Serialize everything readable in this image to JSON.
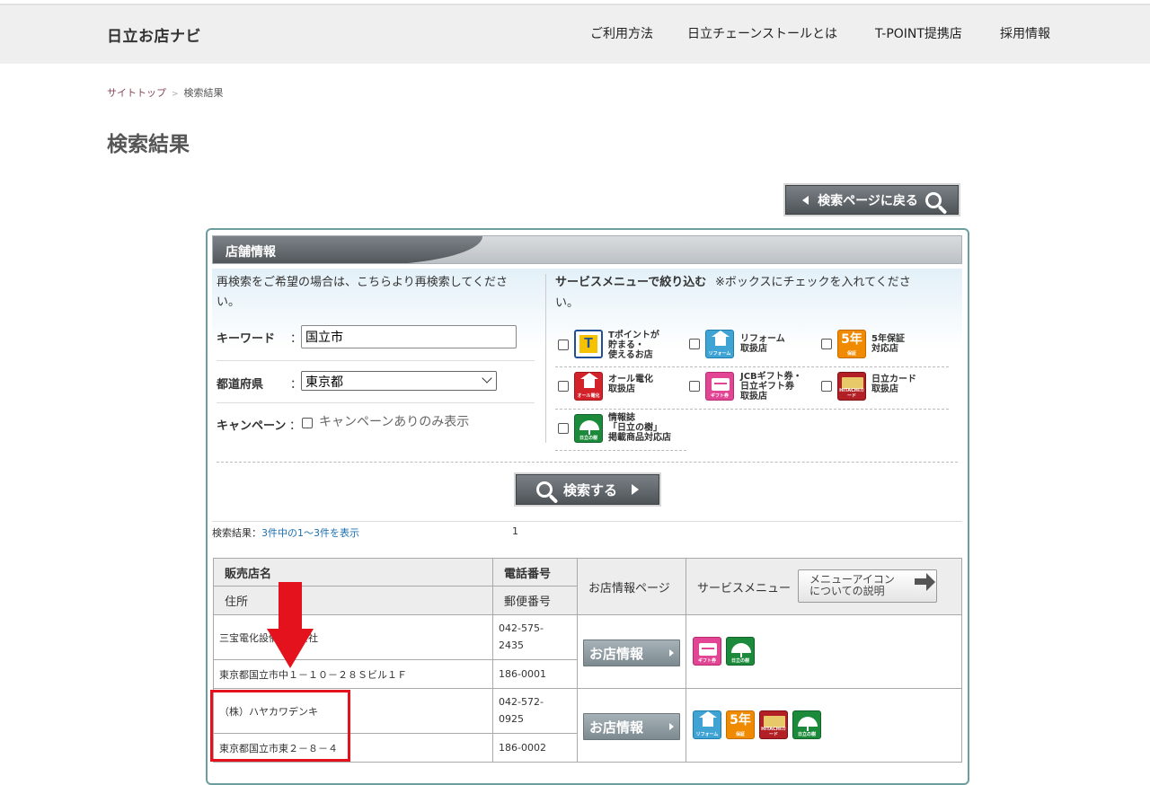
{
  "header": {
    "logo": "日立お店ナビ",
    "nav": [
      "ご利用方法",
      "日立チェーンストールとは",
      "T-POINT提携店",
      "採用情報"
    ]
  },
  "breadcrumb": {
    "home": "サイトトップ",
    "sep": ">",
    "current": "検索結果"
  },
  "page_title": "検索結果",
  "back_button": "検索ページに戻る",
  "panel": {
    "title": "店舗情報",
    "instructions_line1": "再検索をご希望の場合は、こちらより再検索してくださ",
    "instructions_line2": "い。",
    "keyword_label": "キーワード",
    "keyword_value": "国立市",
    "pref_label": "都道府県",
    "pref_value": "東京都",
    "campaign_label": "キャンペーン",
    "campaign_option": "キャンペーンありのみ表示",
    "colon": "：",
    "service_title": "サービスメニューで絞り込む",
    "service_note_line1": "※ボックスにチェックを入れてくださ",
    "service_note_line2": "い。",
    "services": [
      {
        "icon": "t-point-icon",
        "line1": "Tポイントが",
        "line2": "貯まる・",
        "line3": "使えるお店"
      },
      {
        "icon": "reform-icon",
        "line1": "リフォーム",
        "line2": "取扱店",
        "line3": ""
      },
      {
        "icon": "5year-warranty-icon",
        "line1": "5年保証",
        "line2": "対応店",
        "line3": ""
      },
      {
        "icon": "all-electric-icon",
        "line1": "オール電化",
        "line2": "取扱店",
        "line3": ""
      },
      {
        "icon": "gift-card-icon",
        "line1": "JCBギフト券・",
        "line2": "日立ギフト券",
        "line3": "取扱店"
      },
      {
        "icon": "hitachi-card-icon",
        "line1": "日立カード",
        "line2": "取扱店",
        "line3": ""
      },
      {
        "icon": "hitachi-tree-icon",
        "line1": "情報誌",
        "line2": "「日立の樹」",
        "line3": "掲載商品対応店"
      }
    ],
    "search_button": "検索する"
  },
  "results": {
    "summary_prefix": "検索結果：",
    "summary_link": "3件中の1～3件を表示",
    "page": "1",
    "headers": {
      "shop_name": "販売店名",
      "phone": "電話番号",
      "address": "住所",
      "postal": "郵便番号",
      "shop_page": "お店情報ページ",
      "service_menu": "サービスメニュー",
      "menu_icon_button_line1": "メニューアイコン",
      "menu_icon_button_line2": "についての説明"
    },
    "rows": [
      {
        "name": "三宝電化設備株式会社",
        "phone_line1": "042-575-",
        "phone_line2": "2435",
        "address": "東京都国立市中１－１０－２８Ｓビル１Ｆ",
        "postal": "186-0001",
        "button": "お店情報",
        "icons": [
          "gift-card-icon",
          "hitachi-tree-icon"
        ]
      },
      {
        "name": "（株）ハヤカワデンキ",
        "phone_line1": "042-572-",
        "phone_line2": "0925",
        "address": "東京都国立市東２－８－４",
        "postal": "186-0002",
        "button": "お店情報",
        "icons": [
          "reform-icon",
          "5year-warranty-icon",
          "hitachi-card-icon",
          "hitachi-tree-icon"
        ]
      }
    ]
  },
  "icon_text": {
    "reform": "リフォーム",
    "five": "5年",
    "five_sub": "保証",
    "denka": "オール電化",
    "gift": "ギフト券",
    "card": "HITACHIカード",
    "tree": "日立の樹"
  },
  "colors": {
    "accent_teal": "#6d9e9e",
    "highlight_red": "#e3121c",
    "link_blue": "#1a6fb0"
  }
}
